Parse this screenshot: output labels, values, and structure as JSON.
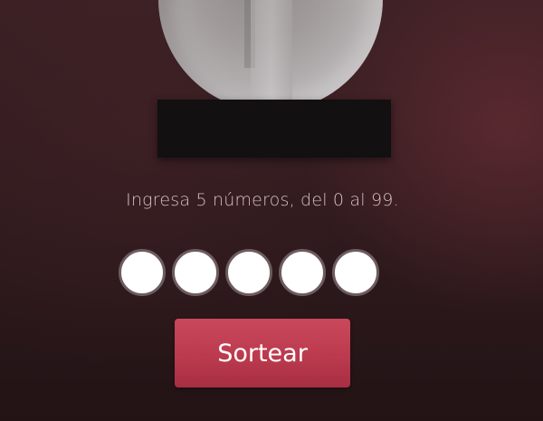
{
  "instruction_text": "Ingresa 5 números, del 0 al 99.",
  "number_inputs": [
    {
      "value": ""
    },
    {
      "value": ""
    },
    {
      "value": ""
    },
    {
      "value": ""
    },
    {
      "value": ""
    }
  ],
  "draw_button_label": "Sortear",
  "colors": {
    "button": "#bc3a4e",
    "text": "#d6bfc4",
    "background": "#2e1a1d",
    "input_border": "#6d5c5f"
  }
}
